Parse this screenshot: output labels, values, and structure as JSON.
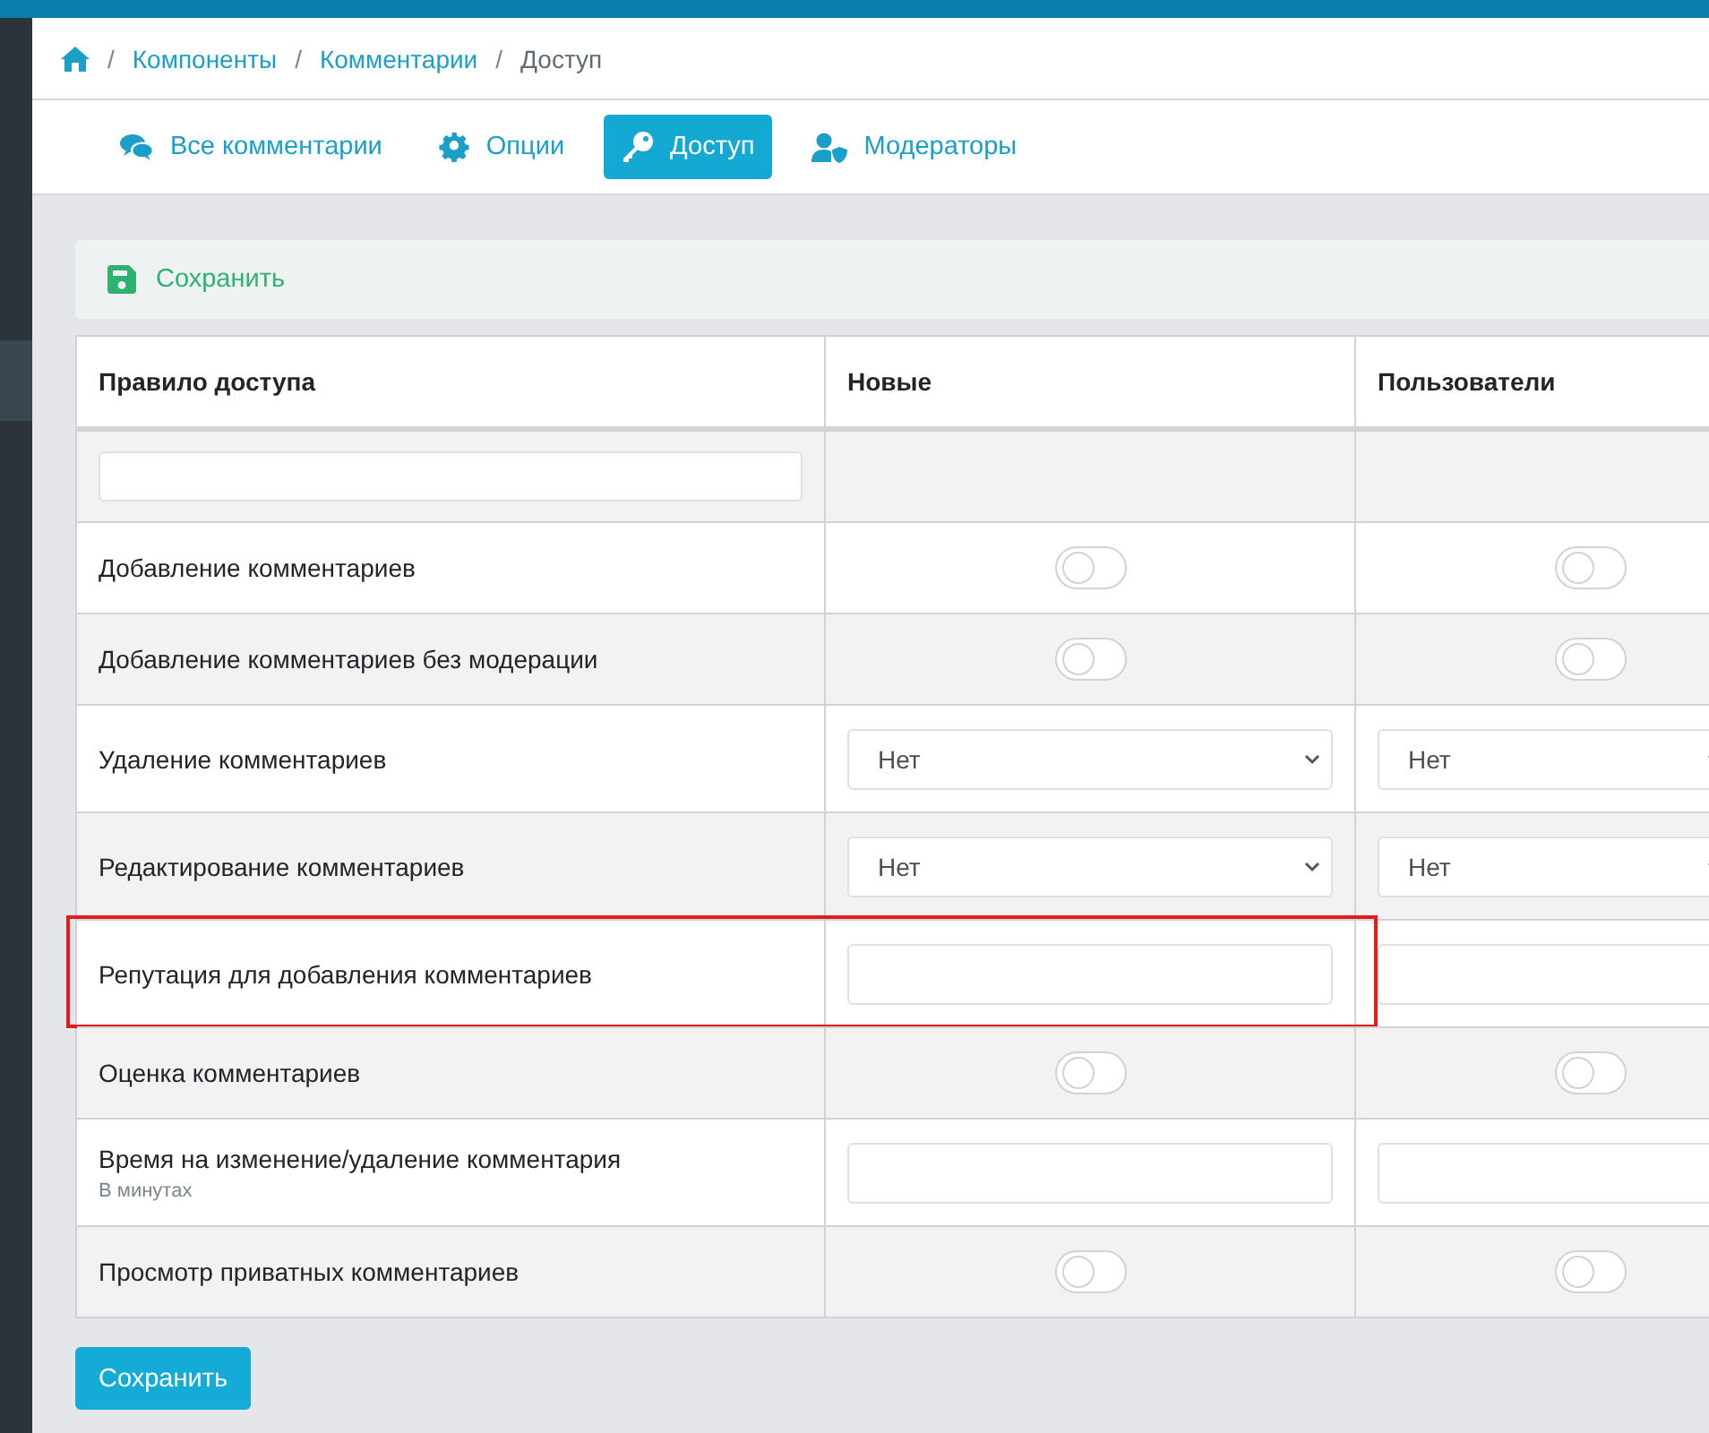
{
  "breadcrumb": [
    {
      "separator": "/",
      "label": "Компоненты",
      "kind": "link"
    },
    {
      "separator": "/",
      "label": "Комментарии",
      "kind": "link"
    },
    {
      "separator": "/",
      "label": "Доступ",
      "kind": "current"
    }
  ],
  "tabs": [
    {
      "label": "Все комментарии",
      "selected": false
    },
    {
      "label": "Опции",
      "selected": false
    },
    {
      "label": "Доступ",
      "selected": true
    },
    {
      "label": "Модераторы",
      "selected": false
    }
  ],
  "toolbar": {
    "save": "Сохранить"
  },
  "table": {
    "columns": [
      "Правило доступа",
      "Новые",
      "Пользователи"
    ],
    "rows": [
      {
        "highlighted": false,
        "cells": [
          {
            "kind": "label",
            "text": "Добавление комментариев"
          },
          {
            "kind": "toggle",
            "on": false
          },
          {
            "kind": "toggle",
            "on": false
          }
        ]
      },
      {
        "highlighted": false,
        "cells": [
          {
            "kind": "label",
            "text": "Добавление комментариев без модерации"
          },
          {
            "kind": "toggle",
            "on": false
          },
          {
            "kind": "toggle",
            "on": false
          }
        ]
      },
      {
        "highlighted": false,
        "cells": [
          {
            "kind": "label",
            "text": "Удаление комментариев"
          },
          {
            "kind": "select",
            "value": "Нет"
          },
          {
            "kind": "select",
            "value": "Нет"
          }
        ]
      },
      {
        "highlighted": false,
        "cells": [
          {
            "kind": "label",
            "text": "Редактирование комментариев"
          },
          {
            "kind": "select",
            "value": "Нет"
          },
          {
            "kind": "select",
            "value": "Нет"
          }
        ]
      },
      {
        "highlighted": true,
        "cells": [
          {
            "kind": "label",
            "text": "Репутация для добавления комментариев"
          },
          {
            "kind": "input"
          },
          {
            "kind": "input"
          }
        ]
      },
      {
        "highlighted": false,
        "cells": [
          {
            "kind": "label",
            "text": "Оценка комментариев"
          },
          {
            "kind": "toggle",
            "on": false
          },
          {
            "kind": "toggle",
            "on": false
          }
        ]
      },
      {
        "highlighted": false,
        "cells": [
          {
            "kind": "label",
            "text": "Время на изменение/удаление комментария",
            "hint": "В минутах"
          },
          {
            "kind": "input"
          },
          {
            "kind": "input"
          }
        ]
      },
      {
        "highlighted": false,
        "cells": [
          {
            "kind": "label",
            "text": "Просмотр приватных комментариев"
          },
          {
            "kind": "toggle",
            "on": false
          },
          {
            "kind": "toggle",
            "on": false
          }
        ]
      }
    ]
  },
  "save_button": "Сохранить"
}
